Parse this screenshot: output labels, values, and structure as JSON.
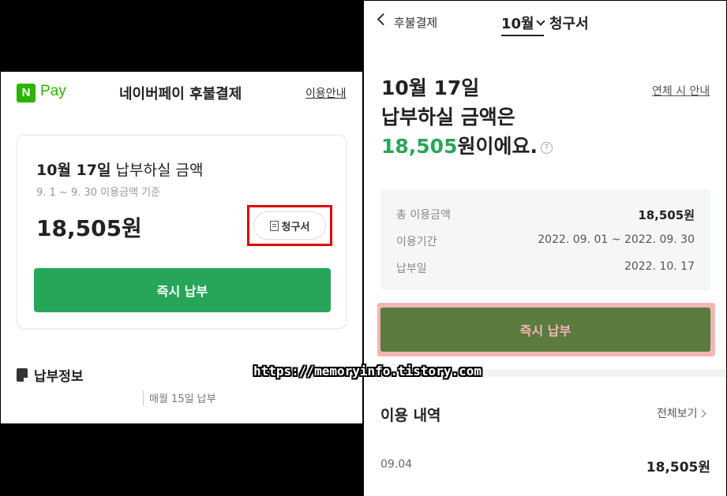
{
  "left": {
    "logo": {
      "mark": "N",
      "text": "Pay"
    },
    "title": "네이버페이 후불결제",
    "guide_link": "이용안내",
    "card": {
      "title_bold": "10월 17일",
      "title_rest": " 납부하실 금액",
      "period": "9. 1 ~ 9. 30 이용금액 기준",
      "amount": "18,505원",
      "bill_button": "청구서",
      "pay_button": "즉시 납부"
    },
    "payment_info": {
      "heading": "납부정보",
      "due_day": "매월 15일 납부"
    }
  },
  "right": {
    "back_label": "후불결제",
    "month": "10월",
    "title": "청구서",
    "headline": {
      "line1": "10월 17일",
      "line2": "납부하실 금액은",
      "amount": "18,505",
      "suffix": "원이에요."
    },
    "help_mark": "?",
    "overdue_link": "연체 시 안내",
    "summary": {
      "total_label": "총 이용금액",
      "total_value": "18,505원",
      "period_label": "이용기간",
      "period_value": "2022. 09. 01 ~ 2022. 09. 30",
      "due_label": "납부일",
      "due_value": "2022. 10. 17"
    },
    "pay_button": "즉시 납부",
    "history": {
      "title": "이용 내역",
      "view_all": "전체보기",
      "items": [
        {
          "date": "09.04",
          "amount": "18,505원"
        }
      ]
    }
  },
  "watermark": "https://memoryinfo.tistory.com",
  "colors": {
    "green": "#27a659",
    "brand_green": "#2db400",
    "highlight_red": "#e30000",
    "highlight_pink": "#f4b5b5"
  }
}
